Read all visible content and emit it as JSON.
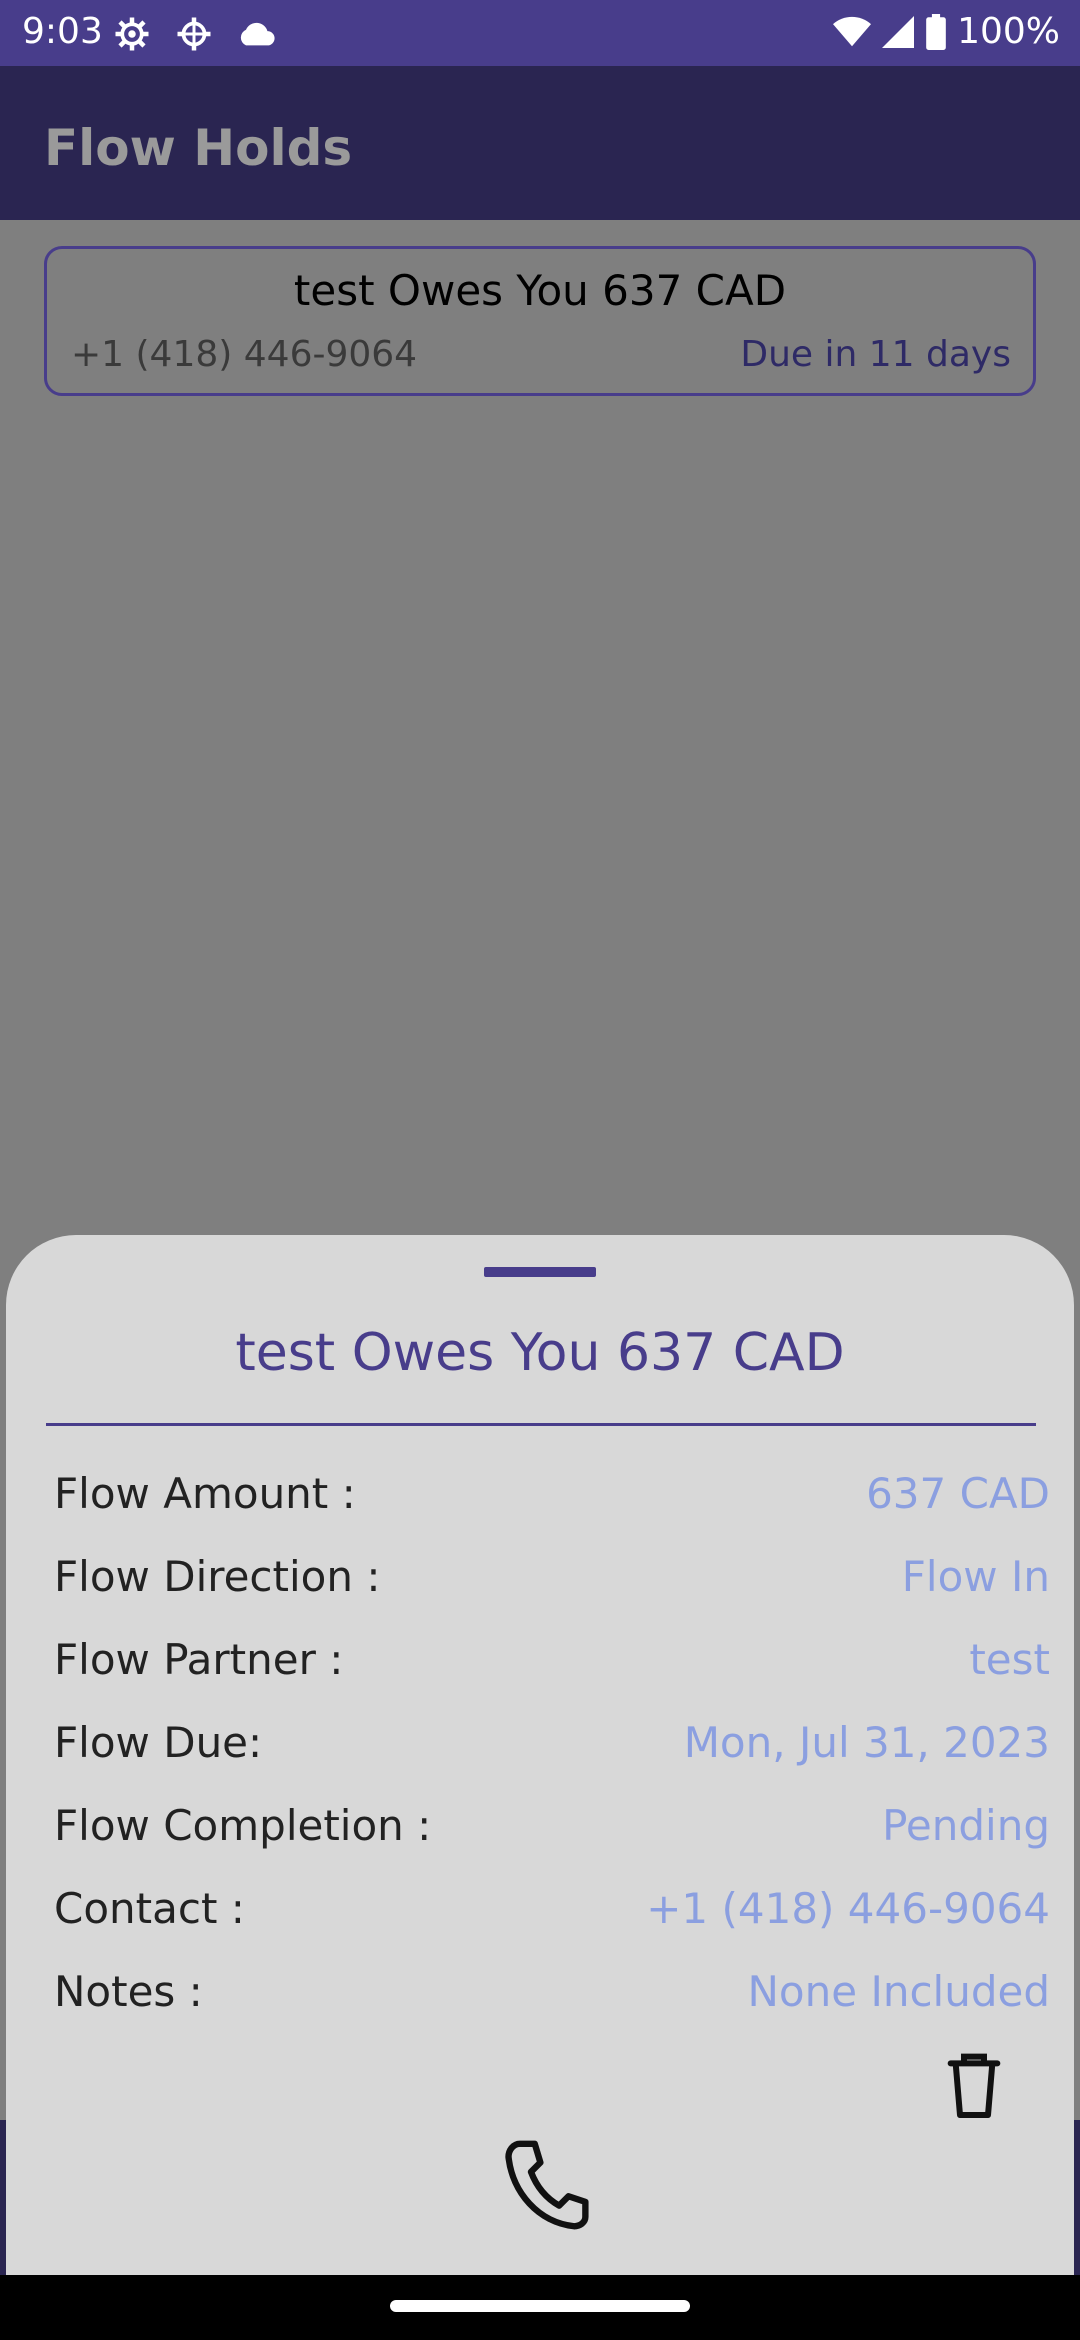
{
  "status_bar": {
    "time": "9:03",
    "battery": "100%"
  },
  "app_bar": {
    "title": "Flow Holds"
  },
  "card": {
    "title": "test Owes You 637 CAD",
    "phone": "+1 (418) 446-9064",
    "due": "Due in 11 days"
  },
  "sheet": {
    "title": "test Owes You 637 CAD",
    "rows": [
      {
        "label": "Flow Amount :",
        "value": "637 CAD"
      },
      {
        "label": "Flow Direction :",
        "value": "Flow In"
      },
      {
        "label": "Flow Partner :",
        "value": "test"
      },
      {
        "label": "Flow Due:",
        "value": "Mon, Jul 31, 2023"
      },
      {
        "label": "Flow Completion :",
        "value": "Pending"
      },
      {
        "label": "Contact :",
        "value": "+1 (418) 446-9064"
      },
      {
        "label": "Notes :",
        "value": "None Included"
      }
    ]
  },
  "icons": {
    "delete": "trash-icon",
    "call": "phone-icon"
  },
  "colors": {
    "primary": "#483d8b",
    "app_bar": "#2a2551",
    "value_text": "#8b9fe0",
    "scrim": "#7f7f7f",
    "sheet_bg": "#d8d8d8"
  }
}
